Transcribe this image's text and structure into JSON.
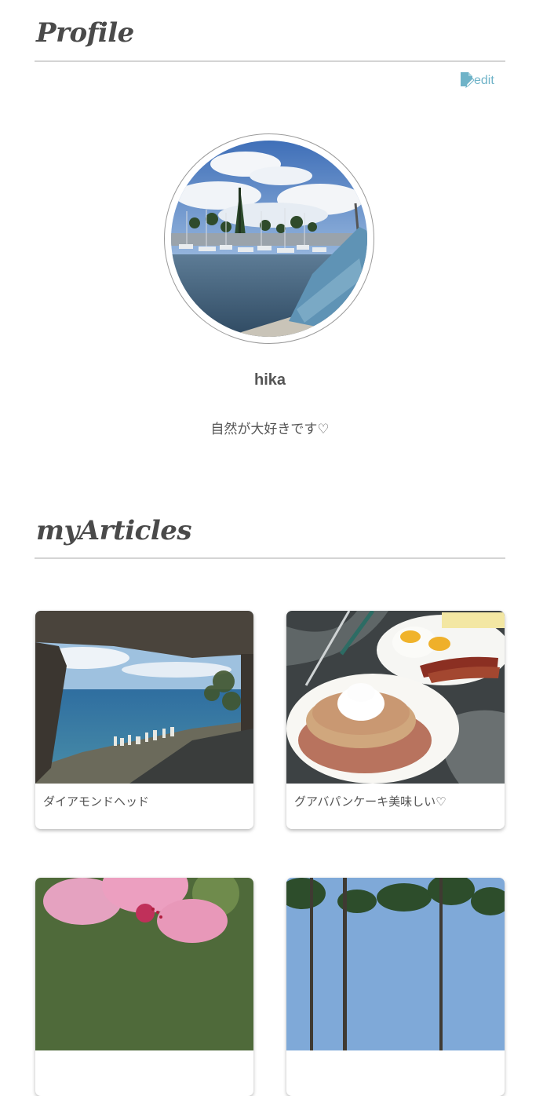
{
  "profile": {
    "section_title": "Profile",
    "edit_label": "edit",
    "edit_icon": "edit-icon",
    "avatar_icon": "harbor-photo",
    "username": "hika",
    "bio": "自然が大好きです♡"
  },
  "articles": {
    "section_title": "myArticles",
    "items": [
      {
        "title": "ダイアモンドヘッド",
        "image": "ocean-view-photo"
      },
      {
        "title": "グアバパンケーキ美味しい♡",
        "image": "pancake-breakfast-photo"
      },
      {
        "title": "",
        "image": "hibiscus-photo"
      },
      {
        "title": "",
        "image": "palm-trees-photo"
      }
    ]
  },
  "colors": {
    "accent": "#6fb3c8",
    "text": "#555555",
    "rule": "#d4d4d4"
  }
}
